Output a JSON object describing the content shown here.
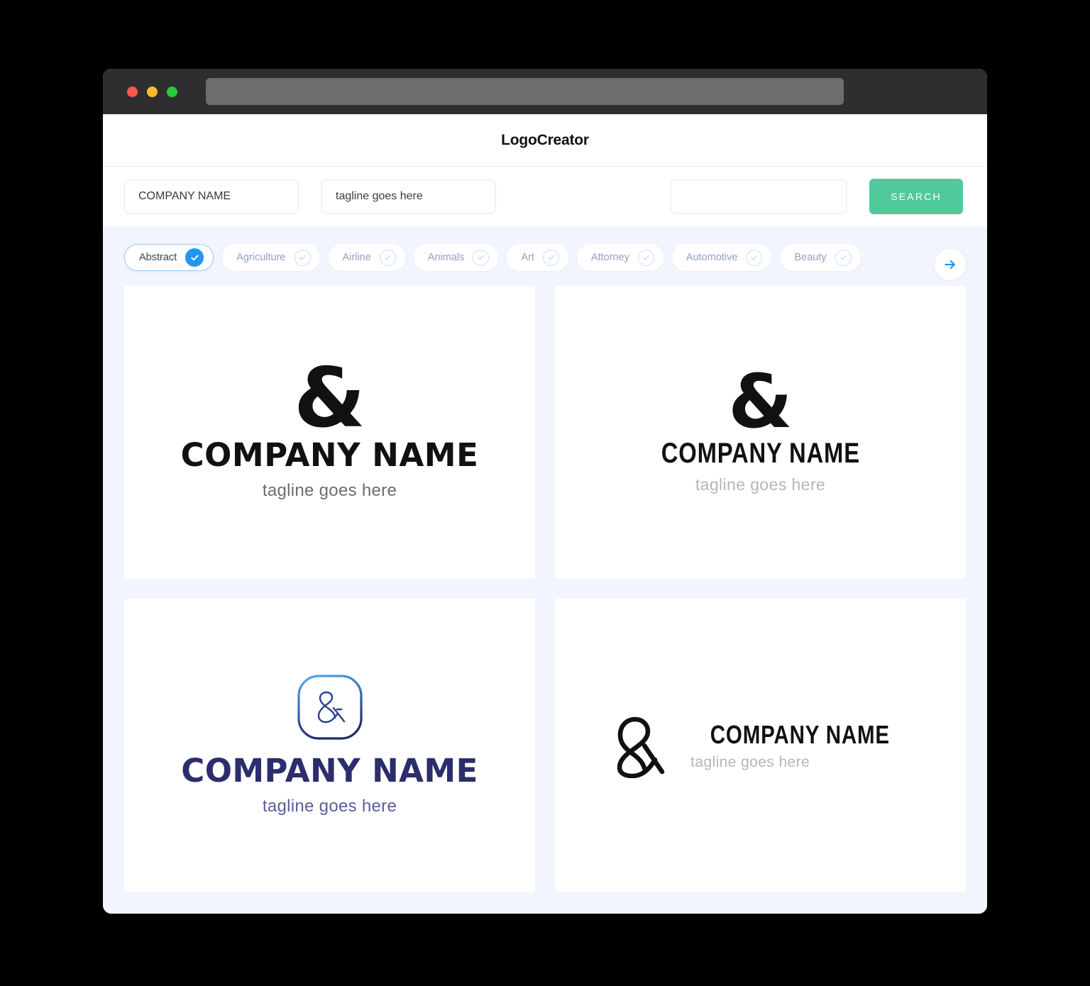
{
  "window": {
    "titlebar": {
      "traffic_lights": [
        {
          "name": "close",
          "color": "#f9584f"
        },
        {
          "name": "minimize",
          "color": "#f8bd2e"
        },
        {
          "name": "maximize",
          "color": "#2ac940"
        }
      ],
      "address_value": "",
      "address_placeholder": ""
    }
  },
  "header": {
    "title": "LogoCreator"
  },
  "search": {
    "company_value": "COMPANY NAME",
    "company_placeholder": "COMPANY NAME",
    "tagline_value": "tagline goes here",
    "tagline_placeholder": "tagline goes here",
    "extra_value": "",
    "extra_placeholder": "",
    "button_label": "SEARCH",
    "button_color": "#50c99b"
  },
  "categories": {
    "selected": "Abstract",
    "accent_color": "#2196f3",
    "next_label": "",
    "items": [
      {
        "label": "Abstract",
        "selected": true
      },
      {
        "label": "Agriculture",
        "selected": false
      },
      {
        "label": "Airline",
        "selected": false
      },
      {
        "label": "Animals",
        "selected": false
      },
      {
        "label": "Art",
        "selected": false
      },
      {
        "label": "Attorney",
        "selected": false
      },
      {
        "label": "Automotive",
        "selected": false
      },
      {
        "label": "Beauty",
        "selected": false
      }
    ]
  },
  "logos": [
    {
      "symbol": "&",
      "name": "COMPANY NAME",
      "tagline": "tagline goes here",
      "style": "stacked-bold-black",
      "name_color": "#111111",
      "tagline_color": "#6d6d70"
    },
    {
      "symbol": "&",
      "name": "COMPANY NAME",
      "tagline": "tagline goes here",
      "style": "stacked-condensed-black",
      "name_color": "#111111",
      "tagline_color": "#b6b6b9"
    },
    {
      "symbol": "&",
      "name": "COMPANY NAME",
      "tagline": "tagline goes here",
      "style": "badge-navy",
      "name_color": "#2b2d6d",
      "tagline_color": "#5a5e9b",
      "badge_gradient_from": "#4da3f5",
      "badge_gradient_to": "#1f2d6e"
    },
    {
      "symbol": "&",
      "name": "COMPANY NAME",
      "tagline": "tagline goes here",
      "style": "horizontal-outline",
      "name_color": "#111111",
      "tagline_color": "#b6b6b9"
    }
  ]
}
